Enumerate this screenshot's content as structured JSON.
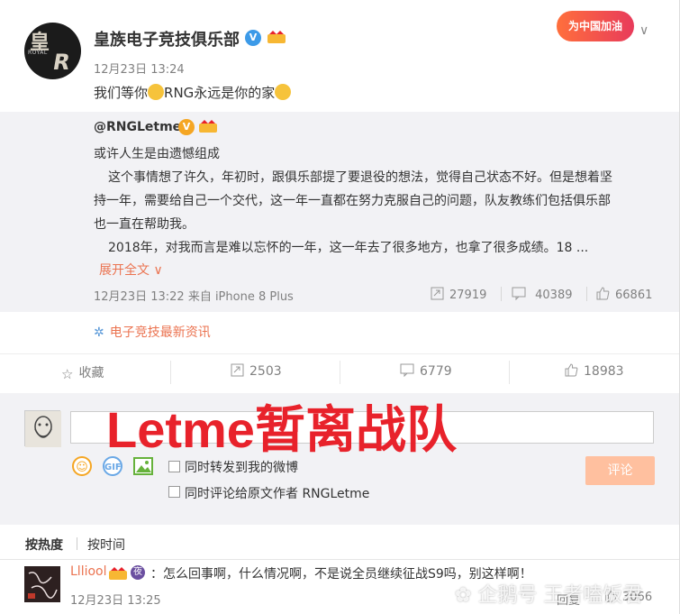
{
  "post": {
    "author": "皇族电子竞技俱乐部",
    "time": "12月23日 13:24",
    "text_before": "我们等你",
    "text_mid": "RNG永远是你的家",
    "promo_badge": "为中国加油"
  },
  "repost": {
    "author": "@RNGLetme",
    "line1": "或许人生是由遗憾组成",
    "line2": "这个事情想了许久，年初时，跟俱乐部提了要退役的想法，觉得自己状态不好。但是想着坚",
    "line3": "持一年，需要给自己一个交代，这一年一直都在努力克服自己的问题，队友教练们包括俱乐部",
    "line4": "也一直在帮助我。",
    "line5": "2018年，对我而言是难以忘怀的一年，这一年去了很多地方，也拿了很多成绩。18 ...",
    "expand": "展开全文 ∨",
    "meta": "12月23日 13:22 来自 iPhone 8 Plus",
    "reposts": "27919",
    "comments": "40389",
    "likes": "66861"
  },
  "topic": "电子竞技最新资讯",
  "actions": {
    "favorite": "收藏",
    "reposts": "2503",
    "comments": "6779",
    "likes": "18983"
  },
  "composer": {
    "overlay_title": "Letme暂离战队",
    "option1": "同时转发到我的微博",
    "option2": "同时评论给原文作者 RNGLetme",
    "submit": "评论"
  },
  "sort": {
    "hot": "按热度",
    "time": "按时间"
  },
  "comment": {
    "user": "Llliool",
    "text": "：怎么回事啊，什么情况啊，不是说全员继续征战S9吗，别这样啊！",
    "time": "12月23日 13:25",
    "reply": "回复",
    "likes": "3066"
  },
  "watermark": "企鹅号 王者嗑饭君",
  "colors": {
    "accent": "#eb7350",
    "overlay_red": "#e8222b",
    "verified_blue": "#3c9ae8",
    "quote_bg": "#f2f2f5"
  }
}
